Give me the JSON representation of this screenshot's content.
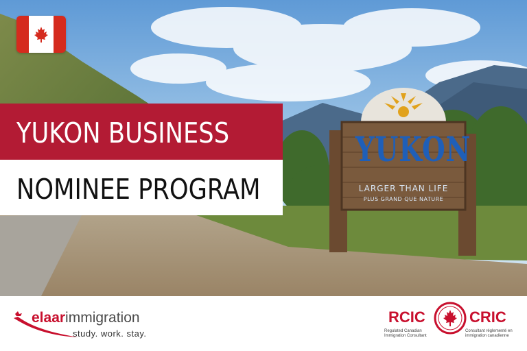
{
  "hero": {
    "title_line1": "YUKON BUSINESS",
    "title_line2": "NOMINEE PROGRAM",
    "sign_main": "YUKON",
    "sign_line1": "LARGER THAN LIFE",
    "sign_line2": "PLUS GRAND QUE NATURE"
  },
  "footer": {
    "brand_part1": "elaar",
    "brand_part2": "immigration",
    "brand_tagline": "study. work. stay.",
    "rcic_left": "RCIC",
    "rcic_right": "CRIC",
    "rcic_sub_left": "Regulated Canadian Immigration Consultant",
    "rcic_sub_right": "Consultant réglementé en immigration canadienne"
  },
  "colors": {
    "brand_red": "#b31b34",
    "canada_red": "#d52b1e",
    "sign_blue": "#1f5fb8"
  },
  "icons": {
    "flag": "canada-flag-icon",
    "maple": "maple-leaf-icon",
    "swoosh": "swoosh-icon",
    "seal": "rcic-seal-icon"
  }
}
